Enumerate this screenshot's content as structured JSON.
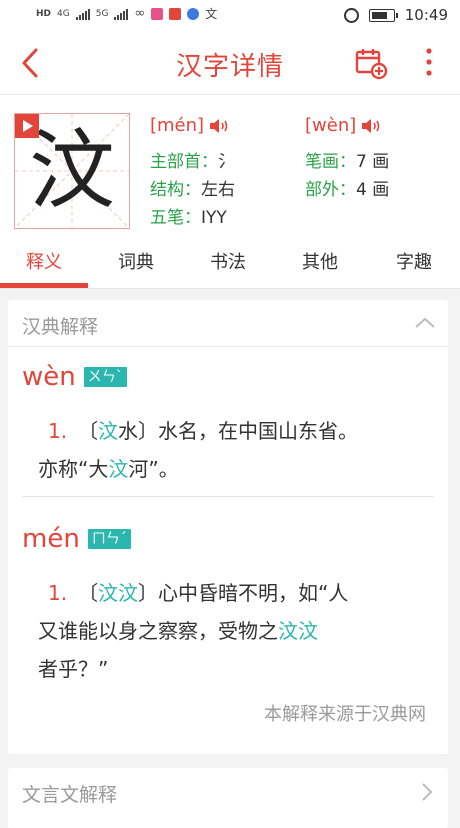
{
  "status": {
    "left_labels": [
      "HD",
      "HD",
      "4G",
      "5G"
    ],
    "time": "10:49"
  },
  "header": {
    "title": "汉字详情"
  },
  "char": {
    "glyph": "汶",
    "pinyin1": "[mén]",
    "pinyin2": "[wèn]",
    "radical_label": "主部首：",
    "radical_value": "氵",
    "strokes_label": "笔画：",
    "strokes_value": "7 画",
    "structure_label": "结构：",
    "structure_value": "左右",
    "outside_label": "部外：",
    "outside_value": "4 画",
    "wubi_label": "五笔：",
    "wubi_value": "IYY"
  },
  "tabs": [
    {
      "label": "释义",
      "active": true
    },
    {
      "label": "词典",
      "active": false
    },
    {
      "label": "书法",
      "active": false
    },
    {
      "label": "其他",
      "active": false
    },
    {
      "label": "字趣",
      "active": false
    }
  ],
  "explain": {
    "heading": "汉典解释",
    "entries": [
      {
        "pinyin": "wèn",
        "bopomofo": "ㄨㄣˋ",
        "num": "1.",
        "line1": [
          "〔",
          "汶",
          "水〕水名，在中国山东省。"
        ],
        "line2": [
          "亦称“大",
          "汶",
          "河”。"
        ]
      },
      {
        "pinyin": "mén",
        "bopomofo": "ㄇㄣˊ",
        "num": "1.",
        "line1": [
          "〔",
          "汶汶",
          "〕心中昏暗不明，如“人"
        ],
        "line2": [
          "又谁能以身之察察，受物之",
          "汶汶",
          ""
        ],
        "line3": "者乎？”"
      }
    ],
    "source": "本解释来源于汉典网"
  },
  "wenyan": {
    "heading": "文言文解释"
  },
  "colors": {
    "accent": "#e3453a",
    "green": "#2aa24a",
    "teal": "#2bb7b0"
  },
  "icons": [
    "back-arrow-icon",
    "calendar-add-icon",
    "more-vertical-icon",
    "play-icon",
    "speaker-icon",
    "chevron-up-icon",
    "chevron-right-icon"
  ]
}
